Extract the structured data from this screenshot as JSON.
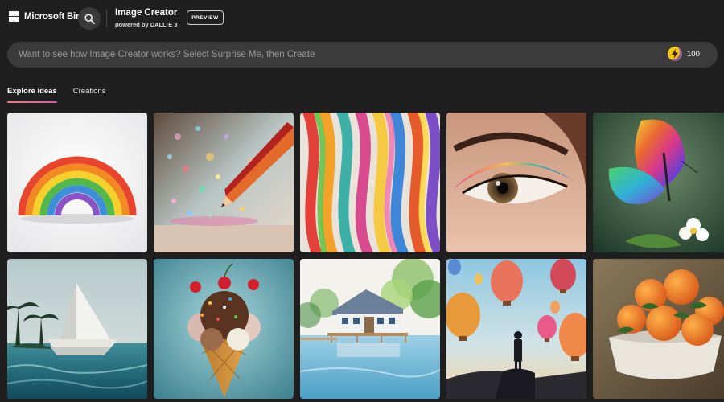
{
  "header": {
    "logo_text": "Microsoft Bing",
    "app_title": "Image Creator",
    "app_subtitle": "powered by DALL·E 3",
    "badge": "PREVIEW"
  },
  "prompt": {
    "placeholder": "Want to see how Image Creator works? Select Surprise Me, then Create",
    "value": ""
  },
  "boosts": {
    "count": "100"
  },
  "tabs": [
    {
      "label": "Explore ideas",
      "active": true
    },
    {
      "label": "Creations",
      "active": false
    }
  ],
  "images": [
    {
      "subject": "paper rainbow arch on white background"
    },
    {
      "subject": "colored pencil with glitter sparkles"
    },
    {
      "subject": "colorful flowing ribbons"
    },
    {
      "subject": "close-up eye with rainbow eyeshadow"
    },
    {
      "subject": "rainbow butterfly with white flowers"
    },
    {
      "subject": "paper sailboat on ocean with palm trees"
    },
    {
      "subject": "ice cream cone with cherries and chocolate scoops"
    },
    {
      "subject": "watercolor lake house with trees"
    },
    {
      "subject": "person silhouette watching hot air balloons"
    },
    {
      "subject": "bowl of oranges oil painting"
    }
  ],
  "colors": {
    "background": "#1f1f1f",
    "tab_underline": "#e06b8f",
    "coin": "#f5c518"
  }
}
